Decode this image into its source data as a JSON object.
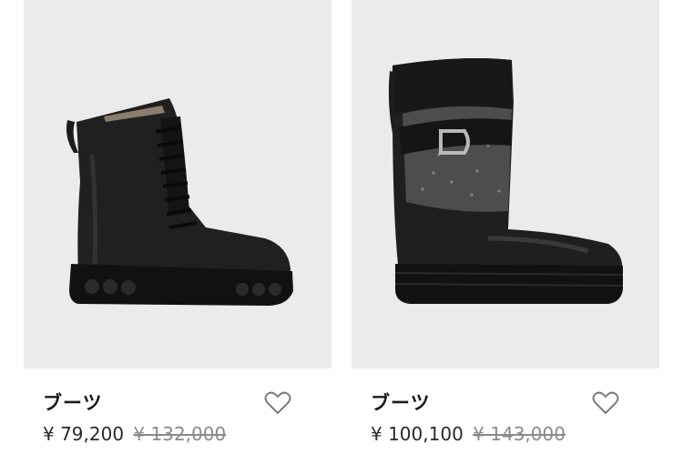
{
  "products": [
    {
      "name": "ブーツ",
      "price": "¥ 79,200",
      "original_price": "¥ 132,000",
      "favorite_icon": "heart-outline-icon",
      "image": "black-leather-lace-up-combat-boot"
    },
    {
      "name": "ブーツ",
      "price": "¥ 100,100",
      "original_price": "¥ 143,000",
      "favorite_icon": "heart-outline-icon",
      "image": "black-leather-glitter-strap-platform-boot"
    }
  ],
  "colors": {
    "image_background": "#ebebeb",
    "text": "#1a1a1a",
    "strikethrough_price": "#8a8a8a",
    "icon": "#7a7a7a"
  }
}
